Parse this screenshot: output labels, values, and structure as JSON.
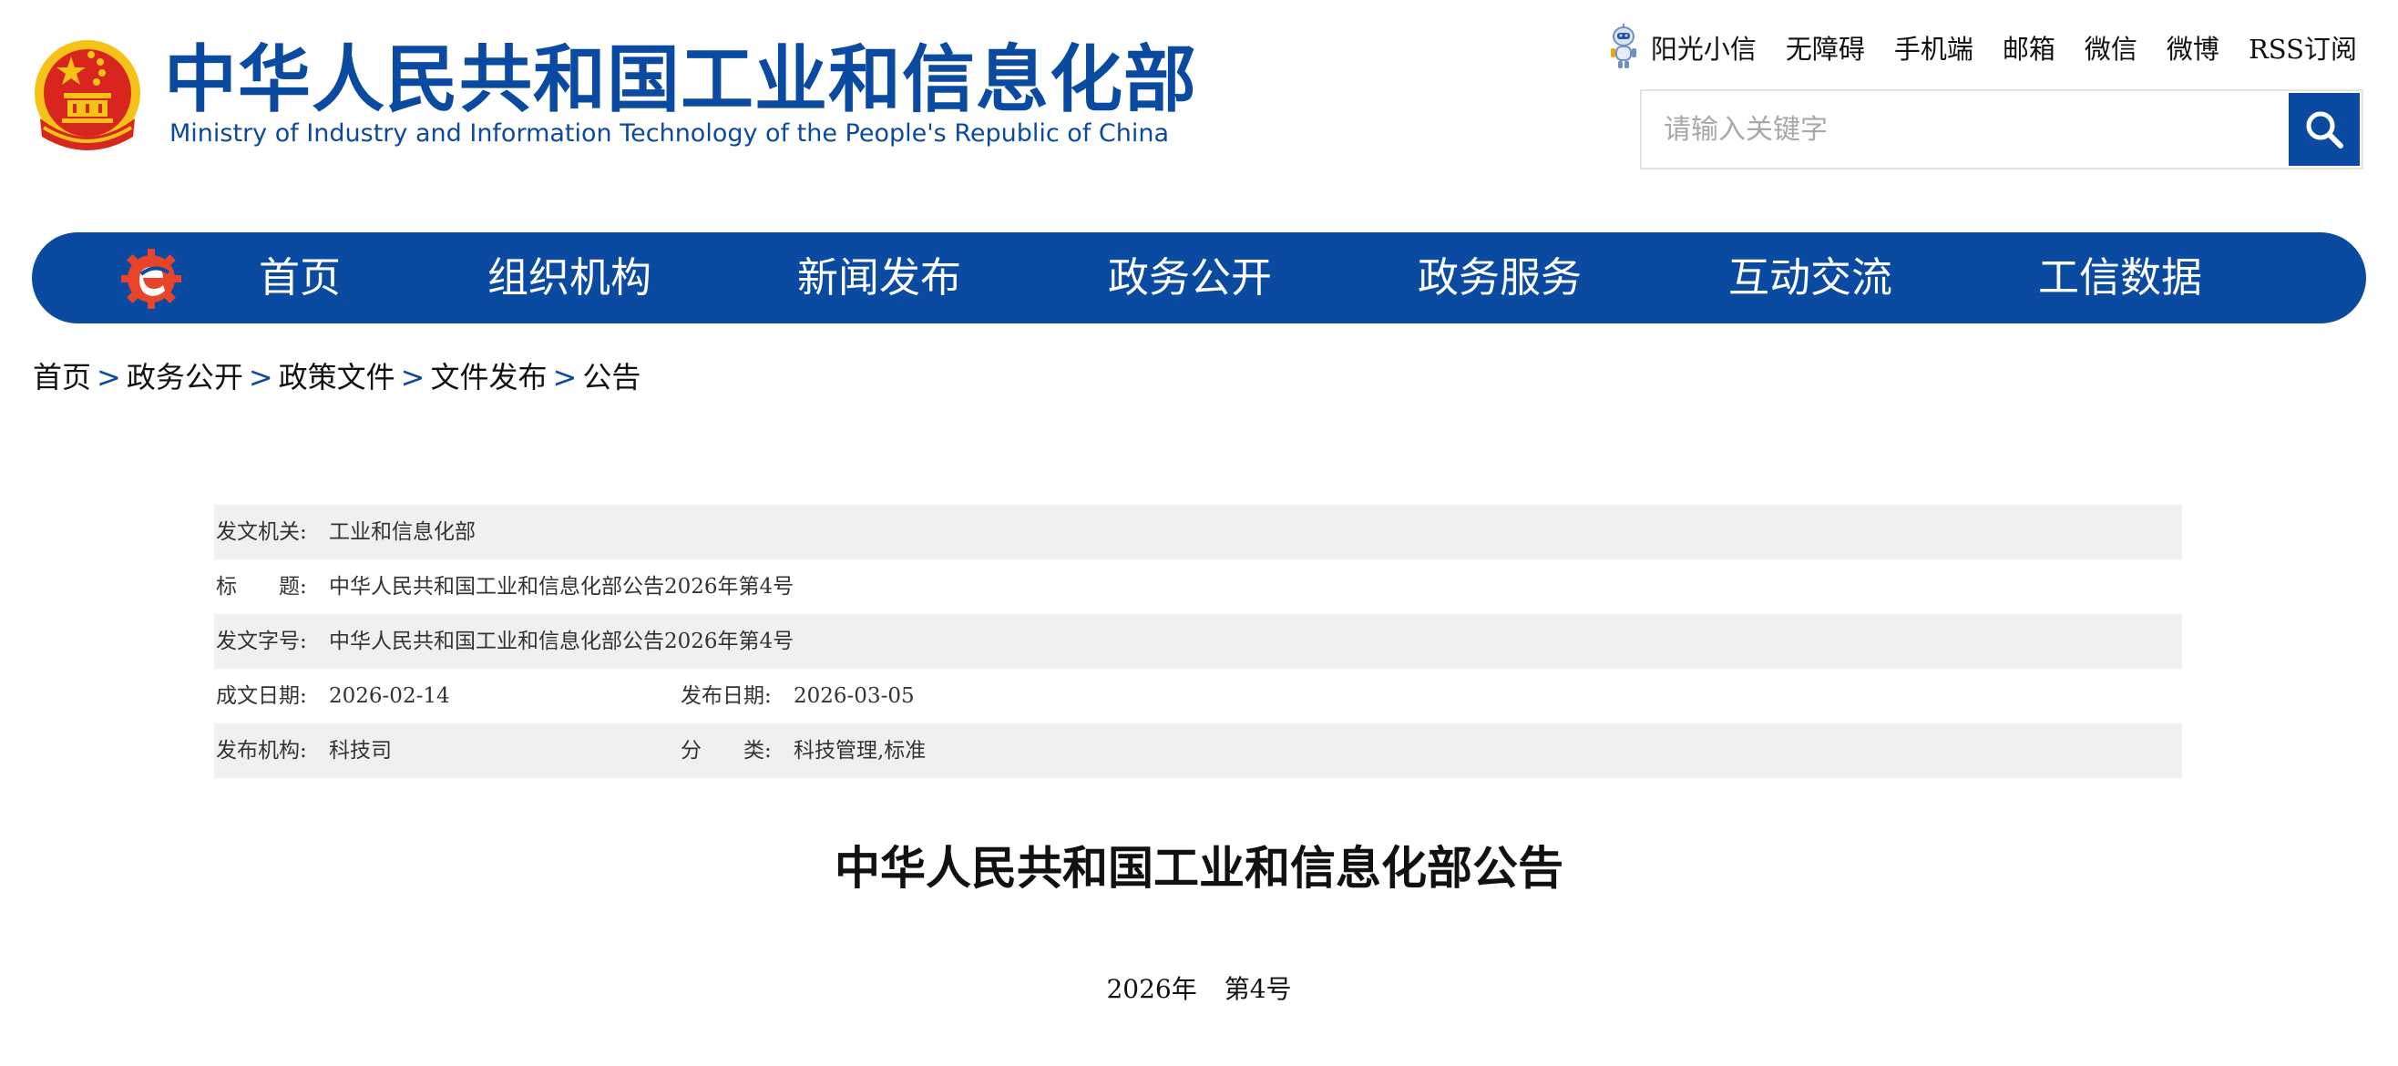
{
  "header": {
    "title_cn": "中华人民共和国工业和信息化部",
    "title_en": "Ministry of Industry and Information Technology of the People's Republic of China",
    "top_links": [
      "阳光小信",
      "无障碍",
      "手机端",
      "邮箱",
      "微信",
      "微博",
      "RSS订阅"
    ],
    "search": {
      "placeholder": "请输入关键字",
      "value": "",
      "icon": "search-icon"
    }
  },
  "nav": {
    "items": [
      "首页",
      "组织机构",
      "新闻发布",
      "政务公开",
      "政务服务",
      "互动交流",
      "工信数据"
    ]
  },
  "breadcrumb": {
    "items": [
      "首页",
      "政务公开",
      "政策文件",
      "文件发布",
      "公告"
    ],
    "separator": ">"
  },
  "meta": {
    "issuer": {
      "label": "发文机关:",
      "value": "工业和信息化部"
    },
    "title": {
      "label": "标　　题:",
      "value": "中华人民共和国工业和信息化部公告2026年第4号"
    },
    "doc_number": {
      "label": "发文字号:",
      "value": "中华人民共和国工业和信息化部公告2026年第4号"
    },
    "written_date": {
      "label": "成文日期:",
      "value": "2026-02-14"
    },
    "publish_date": {
      "label": "发布日期:",
      "value": "2026-03-05"
    },
    "agency": {
      "label": "发布机构:",
      "value": "科技司"
    },
    "category": {
      "label": "分　　类:",
      "value": "科技管理,标准"
    }
  },
  "document": {
    "title": "中华人民共和国工业和信息化部公告",
    "year": "2026年",
    "number": "第4号"
  },
  "colors": {
    "brand_blue": "#0a4aa0",
    "row_shade": "#f0f0f0",
    "emblem_red": "#d8261f",
    "emblem_gold": "#f5c318"
  }
}
